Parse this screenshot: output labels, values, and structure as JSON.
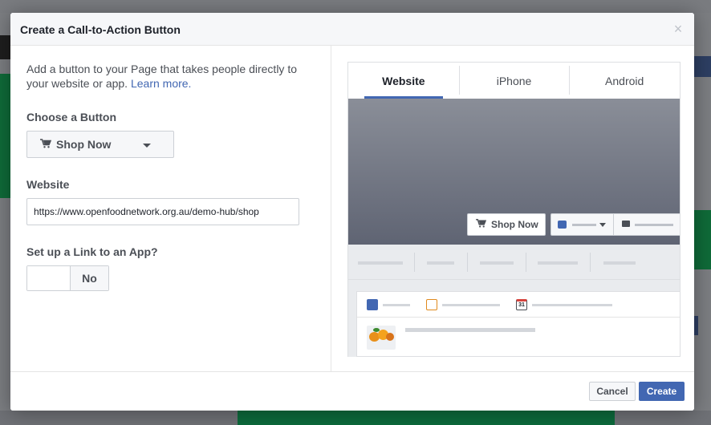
{
  "dialog": {
    "title": "Create a Call-to-Action Button",
    "close_glyph": "×"
  },
  "form": {
    "intro_text": "Add a button to your Page that takes people directly to your website or app.",
    "learn_more_link": "Learn more.",
    "choose_label": "Choose a Button",
    "selected_button": "Shop Now",
    "website_label": "Website",
    "website_value": "https://www.openfoodnetwork.org.au/demo-hub/shop",
    "app_link_label": "Set up a Link to an App?",
    "app_link_toggle": "No"
  },
  "preview": {
    "tabs": [
      {
        "label": "Website",
        "active": true
      },
      {
        "label": "iPhone",
        "active": false
      },
      {
        "label": "Android",
        "active": false
      }
    ],
    "cta_button_label": "Shop Now",
    "calendar_day": "31"
  },
  "footer": {
    "cancel_label": "Cancel",
    "create_label": "Create"
  },
  "colors": {
    "accent": "#4267b2",
    "overlay": "#6b6e74"
  },
  "icons": [
    "shopping-cart-icon",
    "chevron-down-icon",
    "close-icon",
    "like-icon",
    "message-icon",
    "pencil-icon",
    "photo-icon",
    "calendar-icon"
  ]
}
